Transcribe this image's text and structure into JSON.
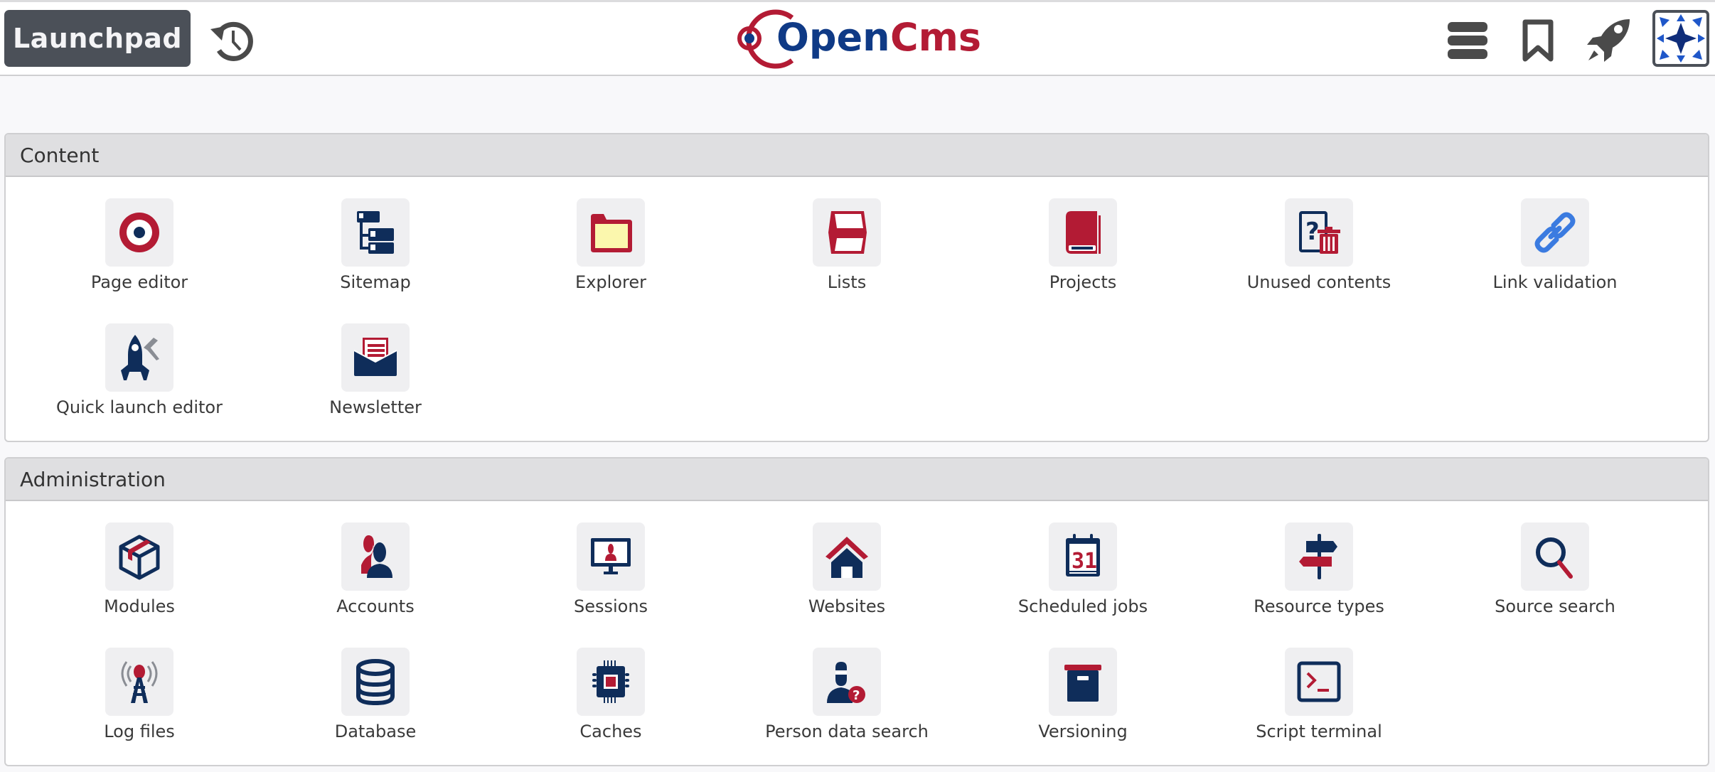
{
  "header": {
    "launchpad_label": "Launchpad",
    "history_icon": "history-icon",
    "logo_text_open": "Open",
    "logo_text_cms": "Cms",
    "menu_icon": "hamburger-menu-icon",
    "bookmark_icon": "bookmark-icon",
    "rocket_icon": "rocket-icon",
    "avatar_icon": "user-avatar"
  },
  "colors": {
    "brand_red": "#b31b34",
    "brand_navy": "#0f2d5a",
    "link_blue": "#3b7be0",
    "toolbar_gray": "#4b5058"
  },
  "sections": [
    {
      "title": "Content",
      "apps": [
        {
          "label": "Page editor",
          "icon": "target-icon"
        },
        {
          "label": "Sitemap",
          "icon": "sitemap-tree-icon"
        },
        {
          "label": "Explorer",
          "icon": "folder-icon"
        },
        {
          "label": "Lists",
          "icon": "folded-list-icon"
        },
        {
          "label": "Projects",
          "icon": "book-icon"
        },
        {
          "label": "Unused contents",
          "icon": "unused-trash-icon"
        },
        {
          "label": "Link validation",
          "icon": "chain-link-icon"
        },
        {
          "label": "Quick launch editor",
          "icon": "rocket-tool-icon"
        },
        {
          "label": "Newsletter",
          "icon": "envelope-letter-icon"
        }
      ]
    },
    {
      "title": "Administration",
      "apps": [
        {
          "label": "Modules",
          "icon": "package-box-icon"
        },
        {
          "label": "Accounts",
          "icon": "users-icon"
        },
        {
          "label": "Sessions",
          "icon": "monitor-user-icon"
        },
        {
          "label": "Websites",
          "icon": "house-icon"
        },
        {
          "label": "Scheduled jobs",
          "icon": "calendar-icon"
        },
        {
          "label": "Resource types",
          "icon": "signpost-icon"
        },
        {
          "label": "Source search",
          "icon": "magnifier-icon"
        },
        {
          "label": "Log files",
          "icon": "antenna-tower-icon"
        },
        {
          "label": "Database",
          "icon": "database-icon"
        },
        {
          "label": "Caches",
          "icon": "cpu-chip-icon"
        },
        {
          "label": "Person data search",
          "icon": "person-question-icon"
        },
        {
          "label": "Versioning",
          "icon": "archive-box-icon"
        },
        {
          "label": "Script terminal",
          "icon": "terminal-icon"
        }
      ]
    }
  ]
}
